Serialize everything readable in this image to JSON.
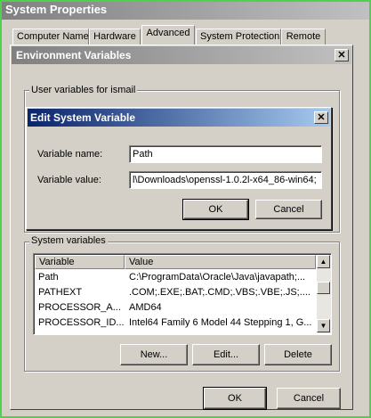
{
  "system_properties": {
    "title": "System Properties",
    "close_glyph": "✕",
    "tabs": [
      "Computer Name",
      "Hardware",
      "Advanced",
      "System Protection",
      "Remote"
    ],
    "active_tab": "Advanced",
    "ok_label": "OK",
    "cancel_label": "Cancel"
  },
  "env_vars": {
    "title": "Environment Variables",
    "close_glyph": "✕",
    "user_group_label": "User variables for ismail",
    "system_group_label": "System variables",
    "columns": [
      "Variable",
      "Value"
    ],
    "rows": [
      {
        "variable": "Path",
        "value": "C:\\ProgramData\\Oracle\\Java\\javapath;..."
      },
      {
        "variable": "PATHEXT",
        "value": ".COM;.EXE;.BAT;.CMD;.VBS;.VBE;.JS;...."
      },
      {
        "variable": "PROCESSOR_A...",
        "value": "AMD64"
      },
      {
        "variable": "PROCESSOR_ID...",
        "value": "Intel64 Family 6 Model 44 Stepping 1, G..."
      }
    ],
    "new_label": "New...",
    "edit_label": "Edit...",
    "delete_label": "Delete"
  },
  "edit_dialog": {
    "title": "Edit System Variable",
    "close_glyph": "✕",
    "name_label": "Variable name:",
    "name_value": "Path",
    "value_label": "Variable value:",
    "value_value": "l\\Downloads\\openssl-1.0.2l-x64_86-win64;",
    "ok_label": "OK",
    "cancel_label": "Cancel"
  },
  "colors": {
    "frame_border": "#4fd14f",
    "active_title_start": "#0a246a",
    "active_title_end": "#a6caf0",
    "inactive_title": "#808080"
  }
}
